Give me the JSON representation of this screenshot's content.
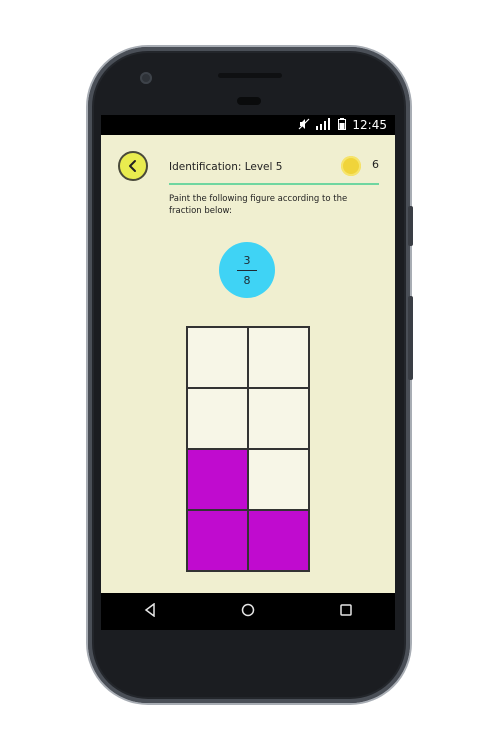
{
  "status_bar": {
    "time": "12:45"
  },
  "header": {
    "title": "Identification: Level 5",
    "coins": "6"
  },
  "instruction": "Paint the following figure according to the fraction below:",
  "fraction": {
    "numerator": "3",
    "denominator": "8"
  },
  "grid": {
    "rows": 4,
    "cols": 2,
    "painted_cells": [
      [
        2,
        0
      ],
      [
        3,
        0
      ],
      [
        3,
        1
      ]
    ],
    "paint_color": "#c00bcf"
  },
  "colors": {
    "app_background": "#f0efd0",
    "back_button": "#e9ec4f",
    "fraction_bubble": "#3fd3f5",
    "coin": "#f0d43a",
    "title_rule": "#6fd6a0"
  },
  "icons": {
    "back": "chevron-left-icon",
    "coin": "coin-icon",
    "nav_back": "triangle-back-icon",
    "nav_home": "circle-home-icon",
    "nav_recents": "square-recents-icon"
  }
}
